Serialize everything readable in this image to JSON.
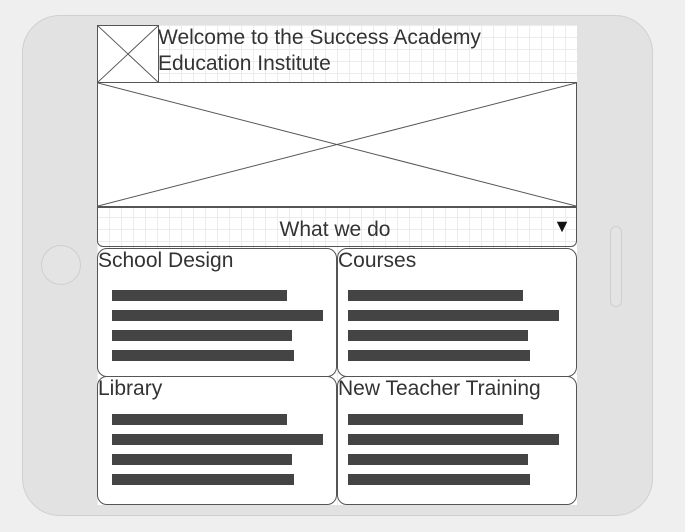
{
  "header": {
    "title": "Welcome to the Success Academy Education Institute"
  },
  "logo": {
    "icon": "image-placeholder-icon"
  },
  "hero": {
    "icon": "image-placeholder-icon"
  },
  "section": {
    "label": "What we do",
    "toggle_icon": "triangle-down-icon"
  },
  "cards": [
    {
      "title": "School Design",
      "line_fractions": [
        0.83,
        1.0,
        0.86,
        0.87
      ]
    },
    {
      "title": "Courses",
      "line_fractions": [
        0.83,
        1.0,
        0.86,
        0.87
      ]
    },
    {
      "title": "Library",
      "line_fractions": [
        0.83,
        1.0,
        0.86,
        0.87
      ]
    },
    {
      "title": "New Teacher Training",
      "line_fractions": [
        0.83,
        1.0,
        0.86,
        0.87
      ]
    }
  ],
  "colors": {
    "device": "#e2e2e2",
    "text": "#333333",
    "text_placeholder_line": "#444444",
    "border": "#555555"
  }
}
